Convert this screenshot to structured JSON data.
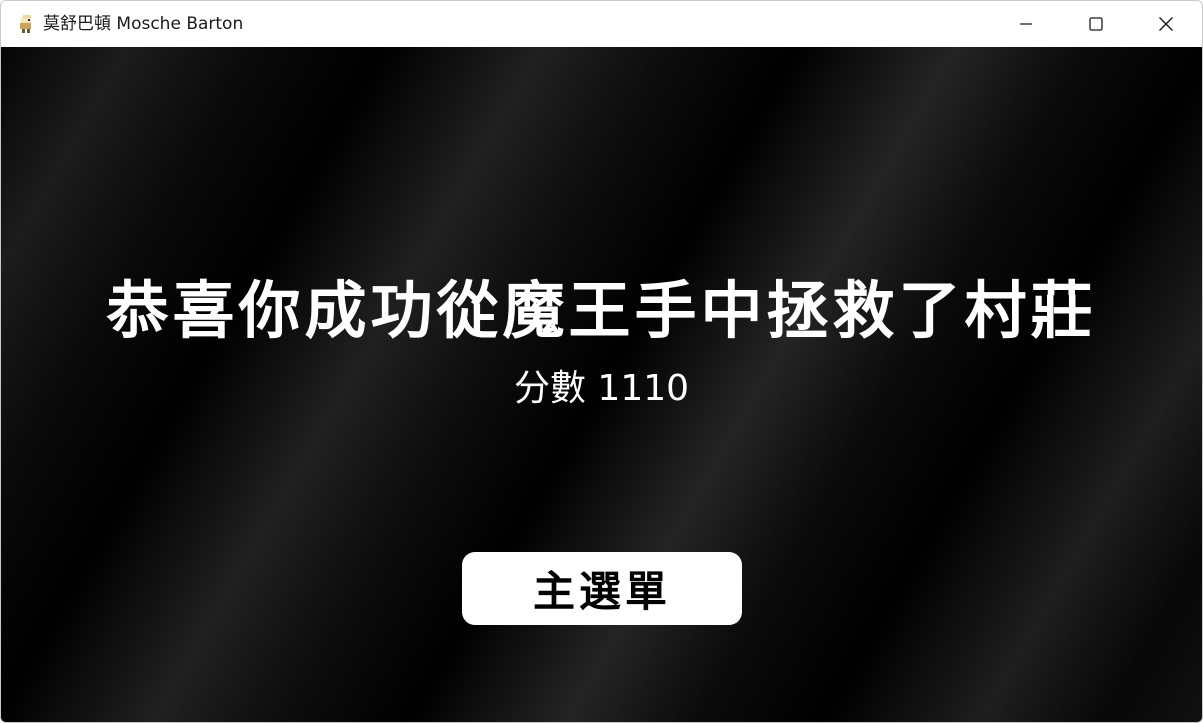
{
  "window": {
    "title": "莫舒巴頓 Mosche Barton",
    "icons": {
      "app": "app-character-icon",
      "minimize": "minimize-icon",
      "maximize": "maximize-icon",
      "close": "close-icon"
    }
  },
  "game": {
    "headline": "恭喜你成功從魔王手中拯救了村莊",
    "score_label": "分數",
    "score_value": "1110",
    "menu_button_label": "主選單"
  },
  "colors": {
    "background": "#000000",
    "text": "#ffffff",
    "button_bg": "#ffffff",
    "button_text": "#000000"
  }
}
